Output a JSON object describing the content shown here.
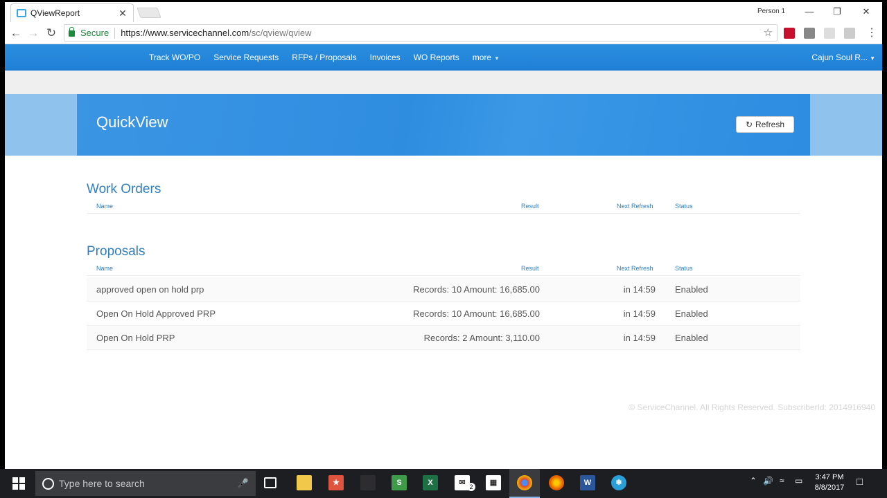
{
  "browser": {
    "tab_title": "QViewReport",
    "tab_close": "✕",
    "profile": "Person 1",
    "secure_label": "Secure",
    "url_host": "https://www.servicechannel.com",
    "url_path": "/sc/qview/qview"
  },
  "nav": {
    "items": [
      "Track WO/PO",
      "Service Requests",
      "RFPs / Proposals",
      "Invoices",
      "WO Reports",
      "more"
    ],
    "user": "Cajun Soul R..."
  },
  "hero": {
    "title": "QuickView",
    "refresh_label": "Refresh"
  },
  "columns": {
    "name": "Name",
    "result": "Result",
    "next_refresh": "Next Refresh",
    "status": "Status"
  },
  "work_orders": {
    "title": "Work Orders",
    "rows": []
  },
  "proposals": {
    "title": "Proposals",
    "rows": [
      {
        "name": "approved open on hold prp",
        "result": "Records: 10 Amount: 16,685.00",
        "next_refresh": "in 14:59",
        "status": "Enabled"
      },
      {
        "name": "Open On Hold Approved PRP",
        "result": "Records: 10 Amount: 16,685.00",
        "next_refresh": "in 14:59",
        "status": "Enabled"
      },
      {
        "name": "Open On Hold PRP",
        "result": "Records: 2 Amount: 3,110.00",
        "next_refresh": "in 14:59",
        "status": "Enabled"
      }
    ]
  },
  "footer": "© ServiceChannel. All Rights Reserved. SubscriberId: 2014916940",
  "taskbar": {
    "search_placeholder": "Type here to search",
    "mail_badge": "2",
    "time": "3:47 PM",
    "date": "8/8/2017"
  },
  "colors": {
    "brand_blue": "#2b8fdf",
    "heading_blue": "#2f7fbf",
    "secure_green": "#1a8a3a"
  }
}
